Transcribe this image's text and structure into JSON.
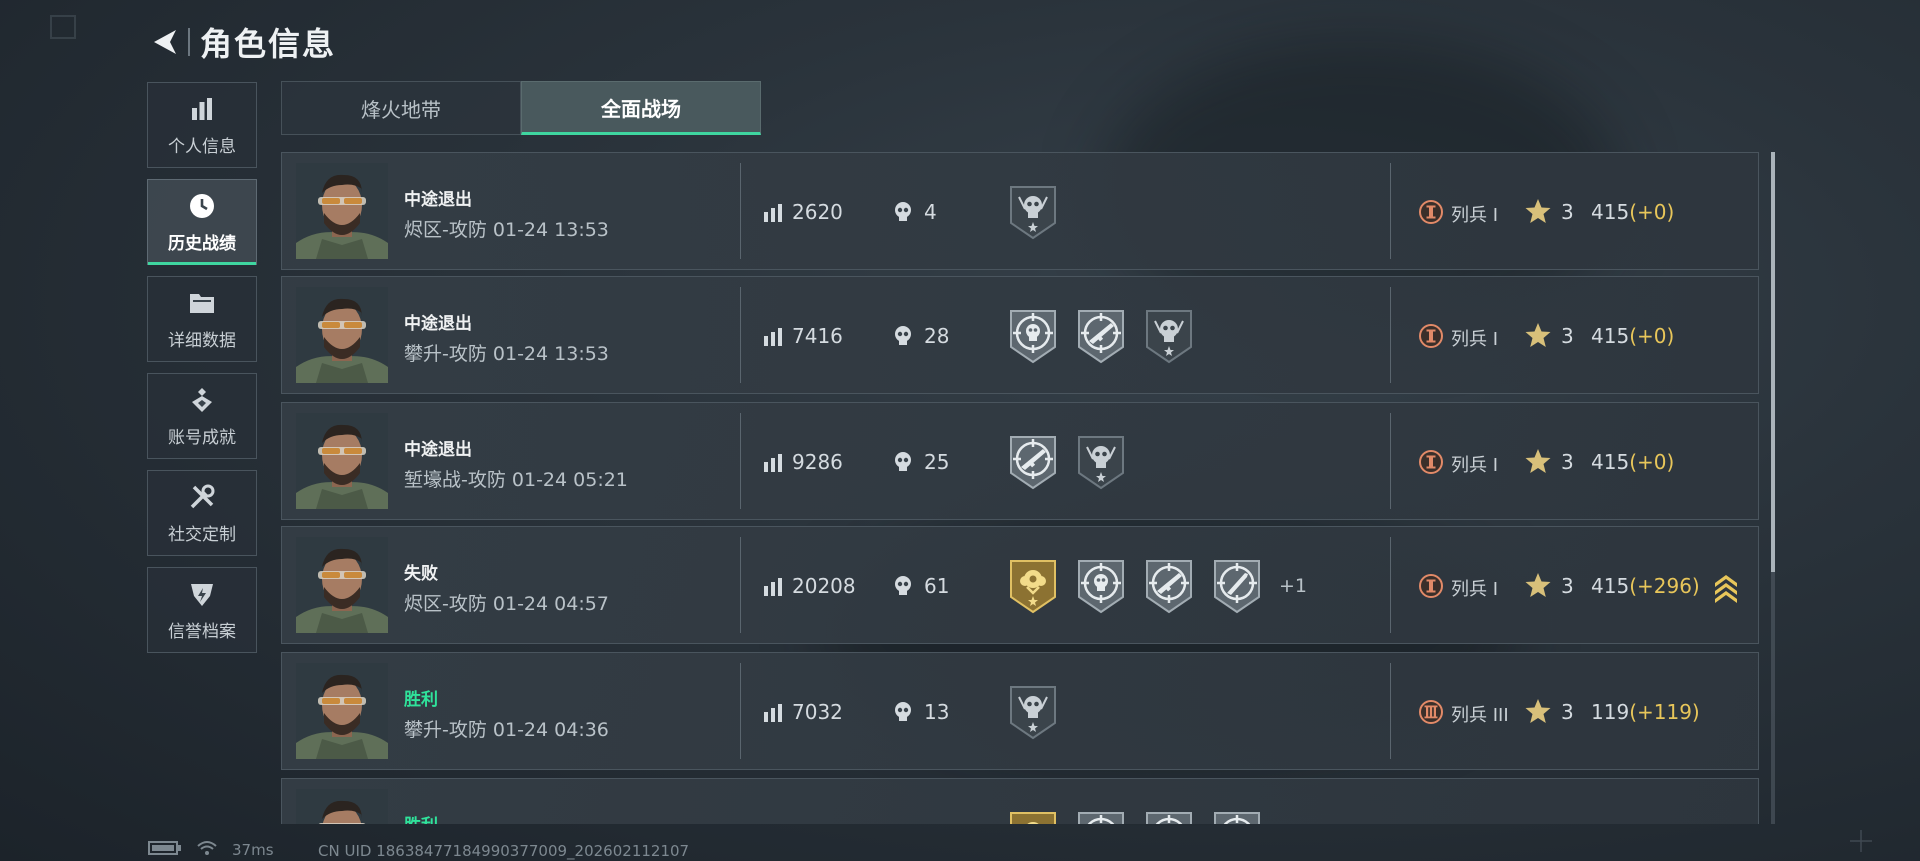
{
  "page_title": "角色信息",
  "sidebar": {
    "items": [
      {
        "label": "个人信息",
        "icon": "bar-chart-icon"
      },
      {
        "label": "历史战绩",
        "icon": "clock-icon"
      },
      {
        "label": "详细数据",
        "icon": "folder-icon"
      },
      {
        "label": "账号成就",
        "icon": "achievement-icon"
      },
      {
        "label": "社交定制",
        "icon": "tools-icon"
      },
      {
        "label": "信誉档案",
        "icon": "credit-shield-icon"
      }
    ],
    "active_index": 1
  },
  "tabs": [
    {
      "label": "烽火地带",
      "active": false
    },
    {
      "label": "全面战场",
      "active": true
    }
  ],
  "matches": [
    {
      "result": "中途退出",
      "win": false,
      "mode": "烬区-攻防 01-24 13:53",
      "score": "2620",
      "kills": "4",
      "badges": [
        "dark-skull-badge"
      ],
      "extra_badges": "",
      "rank": "列兵 I",
      "rank_icon": "rank-1-emblem",
      "stars": "3",
      "points": "415",
      "delta": "(+0)",
      "rank_up": false
    },
    {
      "result": "中途退出",
      "win": false,
      "mode": "攀升-攻防 01-24 13:53",
      "score": "7416",
      "kills": "28",
      "badges": [
        "skull-target-badge",
        "rifle-target-badge",
        "dark-skull-badge"
      ],
      "extra_badges": "",
      "rank": "列兵 I",
      "rank_icon": "rank-1-emblem",
      "stars": "3",
      "points": "415",
      "delta": "(+0)",
      "rank_up": false
    },
    {
      "result": "中途退出",
      "win": false,
      "mode": "堑壕战-攻防 01-24 05:21",
      "score": "9286",
      "kills": "25",
      "badges": [
        "rifle-target-badge",
        "dark-skull-badge"
      ],
      "extra_badges": "",
      "rank": "列兵 I",
      "rank_icon": "rank-1-emblem",
      "stars": "3",
      "points": "415",
      "delta": "(+0)",
      "rank_up": false
    },
    {
      "result": "失败",
      "win": false,
      "mode": "烬区-攻防 01-24 04:57",
      "score": "20208",
      "kills": "61",
      "badges": [
        "gold-rose-badge",
        "skull-target-badge",
        "rifle-target-badge",
        "knife-target-badge"
      ],
      "extra_badges": "+1",
      "rank": "列兵 I",
      "rank_icon": "rank-1-emblem",
      "stars": "3",
      "points": "415",
      "delta": "(+296)",
      "rank_up": true
    },
    {
      "result": "胜利",
      "win": true,
      "mode": "攀升-攻防 01-24 04:36",
      "score": "7032",
      "kills": "13",
      "badges": [
        "dark-skull-badge"
      ],
      "extra_badges": "",
      "rank": "列兵 III",
      "rank_icon": "rank-3-emblem",
      "stars": "3",
      "points": "119",
      "delta": "(+119)",
      "rank_up": false
    },
    {
      "result": "胜利",
      "win": true,
      "mode": "",
      "score": "",
      "kills": "",
      "badges": [
        "gold-rose-badge",
        "skull-target-badge",
        "rifle-target-badge",
        "knife-target-badge"
      ],
      "extra_badges": "",
      "rank": "",
      "rank_icon": "",
      "stars": "",
      "points": "",
      "delta": "",
      "rank_up": false
    }
  ],
  "status": {
    "ping": "37ms",
    "uid": "CN UID 18638477184990377009_202602112107"
  },
  "colors": {
    "accent": "#3fd6a0",
    "win_text": "#2fe39b",
    "delta_gold": "#e8c65a"
  }
}
